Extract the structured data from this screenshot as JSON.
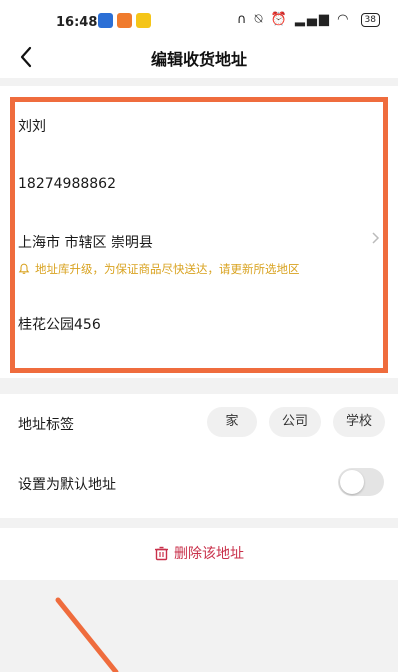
{
  "status_bar": {
    "time": "16:48",
    "battery": "38"
  },
  "nav": {
    "title": "编辑收货地址"
  },
  "form": {
    "name": "刘刘",
    "phone": "18274988862",
    "region": "上海市 市辖区 崇明县",
    "notice": "地址库升级，为保证商品尽快送达，请更新所选地区",
    "detail": "桂花公园456"
  },
  "labels": {
    "title": "地址标签",
    "tags": [
      "家",
      "公司",
      "学校"
    ]
  },
  "default_address": {
    "label": "设置为默认地址",
    "enabled": false
  },
  "actions": {
    "delete_label": "删除该地址"
  },
  "colors": {
    "highlight": "#ef6c3d",
    "notice": "#d9a321",
    "delete": "#c9304a"
  }
}
